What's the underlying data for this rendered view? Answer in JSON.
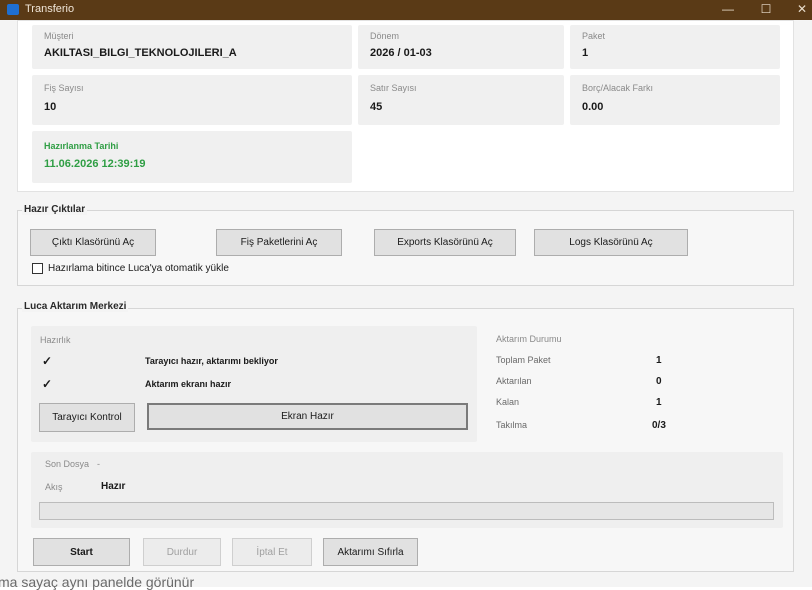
{
  "window": {
    "title": "Transferio",
    "minimize": "—",
    "maximize": "☐",
    "close": "✕"
  },
  "summary": {
    "musteri_label": "Müşteri",
    "musteri_value": "AKILTASI_BILGI_TEKNOLOJILERI_A",
    "donem_label": "Dönem",
    "donem_value": "2026 / 01-03",
    "paket_label": "Paket",
    "paket_value": "1",
    "fis_label": "Fiş Sayısı",
    "fis_value": "10",
    "satir_label": "Satır Sayısı",
    "satir_value": "45",
    "borc_label": "Borç/Alacak Farkı",
    "borc_value": "0.00",
    "hazirlanma_label": "Hazırlanma Tarihi",
    "hazirlanma_value": "11.06.2026 12:39:19"
  },
  "outputs": {
    "title": "Hazır Çıktılar",
    "buttons": [
      "Çıktı Klasörünü Aç",
      "Fiş Paketlerini Aç",
      "Exports Klasörünü Aç",
      "Logs Klasörünü Aç"
    ],
    "auto_load_label": "Hazırlama bitince Luca'ya otomatik yükle"
  },
  "luca": {
    "title": "Luca Aktarım Merkezi",
    "hazirlik_label": "Hazırlık",
    "check_mark": "✓",
    "status1": "Tarayıcı hazır, aktarımı bekliyor",
    "status2": "Aktarım ekranı hazır",
    "tarayici_button": "Tarayıcı Kontrol",
    "ekran_button": "Ekran Hazır",
    "durum_title": "Aktarım Durumu",
    "toplam_label": "Toplam Paket",
    "toplam_value": "1",
    "aktarilan_label": "Aktarılan",
    "aktarilan_value": "0",
    "kalan_label": "Kalan",
    "kalan_value": "1",
    "takilma_label": "Takılma",
    "takilma_value": "0/3",
    "son_dosya_label": "Son Dosya",
    "son_dosya_value": "-",
    "akis_label": "Akış",
    "akis_value": "Hazır",
    "progress": 0
  },
  "actions": {
    "start": "Start",
    "durdur": "Durdur",
    "iptal": "İptal Et",
    "sifirla": "Aktarımı Sıfırla"
  },
  "overlay": {
    "caption": "ma sayaç aynı panelde görünür"
  }
}
